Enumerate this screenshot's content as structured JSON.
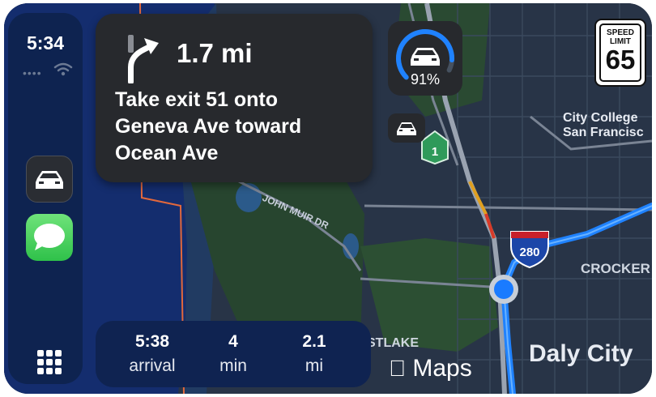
{
  "status": {
    "time": "5:34"
  },
  "navigation": {
    "distance": "1.7 mi",
    "instruction_line1": "Take exit 51 onto",
    "instruction_line2": "Geneva Ave toward",
    "instruction_line3": "Ocean Ave"
  },
  "trip": {
    "arrival_value": "5:38",
    "arrival_label": "arrival",
    "duration_value": "4",
    "duration_label": "min",
    "distance_value": "2.1",
    "distance_label": "mi"
  },
  "vehicle": {
    "battery_percent": 91,
    "battery_text": "91%"
  },
  "speed_limit": {
    "label_line1": "SPEED",
    "label_line2": "LIMIT",
    "value": "65"
  },
  "map": {
    "label_john_muir": "JOHN MUIR DR",
    "label_city_college_1": "City College",
    "label_city_college_2": "San Francisc",
    "label_crocker": "CROCKER",
    "label_daly_city": "Daly City",
    "label_lake": "STLAKE",
    "shield_280": "280",
    "shield_1": "1",
    "brand": "Maps"
  },
  "icons": {
    "turn": "bear-right-arrow-icon",
    "car": "car-icon",
    "messages": "messages-icon",
    "apps": "app-grid-icon",
    "wifi": "wifi-icon",
    "apple": "apple-logo-icon"
  },
  "colors": {
    "route": "#1f82ff",
    "position": "#1a7bff",
    "ocean": "#142d6e",
    "land": "#27452f"
  }
}
